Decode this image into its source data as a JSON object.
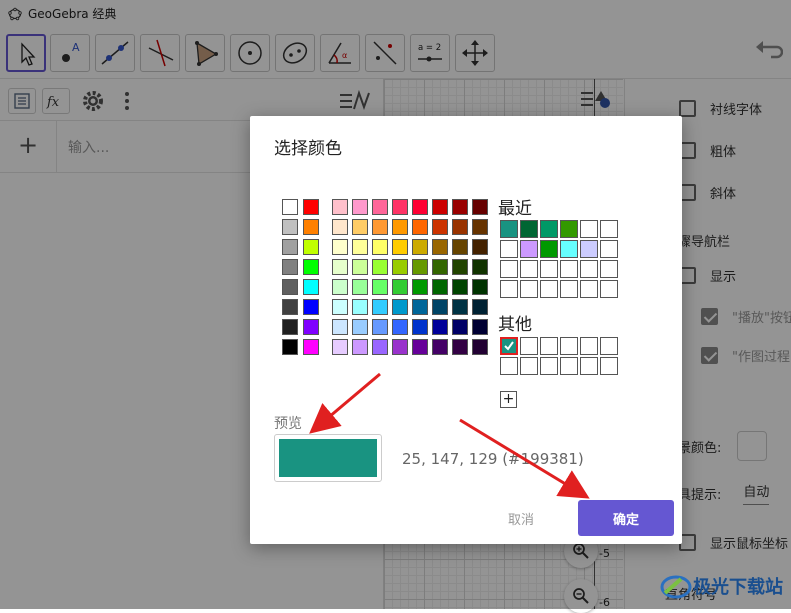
{
  "window": {
    "title": "GeoGebra 经典"
  },
  "toolbar": {
    "tools": [
      "move",
      "point",
      "line",
      "perpendicular",
      "polygon",
      "circle",
      "conic",
      "angle",
      "reflect",
      "slider",
      "move-view"
    ],
    "slider_label": "a = 2"
  },
  "algebra": {
    "input_placeholder": "输入..."
  },
  "graphics": {
    "y_labels": [
      "-5",
      "-6"
    ]
  },
  "properties": {
    "rows": {
      "serif": "衬线字体",
      "bold": "粗体",
      "italic": "斜体",
      "nav_section": "步骤导航栏",
      "show": "显示",
      "play_button": "\"播放\"按钮",
      "construction_steps": "\"作图过程\"",
      "bg_color": "背景颜色:",
      "tooltips": "工具提示:",
      "tooltips_value": "自动",
      "show_mouse_coords": "显示鼠标坐标",
      "right_angle": "直角符号"
    }
  },
  "dialog": {
    "title": "选择颜色",
    "recent_label": "最近",
    "other_label": "其他",
    "preview_label": "预览",
    "preview_color": "#199381",
    "preview_value": "25, 147, 129 (#199381)",
    "add_label": "+",
    "cancel_label": "取消",
    "ok_label": "确定",
    "grays": [
      [
        "#ffffff",
        "#ff0000"
      ],
      [
        "#c0c0c0",
        "#ff8000"
      ],
      [
        "#a0a0a0",
        "#c0ff00"
      ],
      [
        "#808080",
        "#00ff00"
      ],
      [
        "#606060",
        "#00ffff"
      ],
      [
        "#404040",
        "#0000ff"
      ],
      [
        "#202020",
        "#8000ff"
      ],
      [
        "#000000",
        "#ff00ff"
      ]
    ],
    "palette": [
      [
        "#ffc0cb",
        "#ff99cc",
        "#ff6699",
        "#ff3366",
        "#ff0033",
        "#cc0000",
        "#990000",
        "#660000"
      ],
      [
        "#ffe6cc",
        "#ffcc66",
        "#ff9933",
        "#ff9900",
        "#ff6600",
        "#cc3300",
        "#993300",
        "#663300"
      ],
      [
        "#ffffcc",
        "#ffff99",
        "#ffff66",
        "#ffcc00",
        "#ccaa00",
        "#996600",
        "#664400",
        "#442200"
      ],
      [
        "#e6ffcc",
        "#ccff99",
        "#99ff33",
        "#99cc00",
        "#669900",
        "#336600",
        "#224400",
        "#113300"
      ],
      [
        "#ccffcc",
        "#99ff99",
        "#66ff66",
        "#33cc33",
        "#009900",
        "#006600",
        "#004400",
        "#003300"
      ],
      [
        "#ccffff",
        "#99ffff",
        "#33ccff",
        "#0099cc",
        "#006699",
        "#004466",
        "#003344",
        "#002233"
      ],
      [
        "#cce6ff",
        "#99ccff",
        "#6699ff",
        "#3366ff",
        "#0033cc",
        "#000099",
        "#000066",
        "#000033"
      ],
      [
        "#e6ccff",
        "#cc99ff",
        "#9966ff",
        "#9933cc",
        "#660099",
        "#440066",
        "#330044",
        "#220033"
      ]
    ],
    "recent": [
      [
        "#199381",
        "#006633",
        "#009966",
        "#339900",
        "#ffffff",
        "#ffffff"
      ],
      [
        "#ffffff",
        "#cc99ff",
        "#009900",
        "#66ffff",
        "#ccccff",
        "#ffffff"
      ]
    ],
    "other": [
      [
        "#199381",
        "#ffffff",
        "#ffffff",
        "#ffffff",
        "#ffffff",
        "#ffffff"
      ]
    ]
  },
  "watermark": {
    "text": "极光下载站"
  },
  "colors": {
    "accent": "#6557d2",
    "annotation": "#e02020"
  }
}
